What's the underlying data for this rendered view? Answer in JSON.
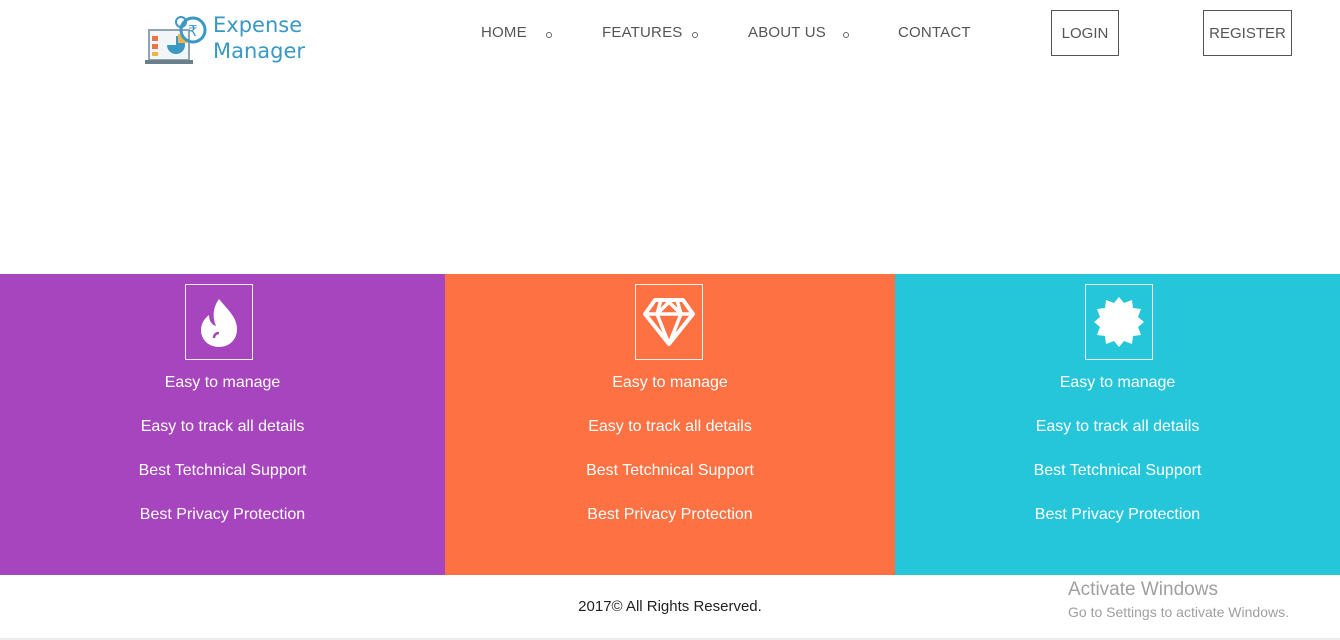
{
  "brand": {
    "line1": "Expense",
    "line2": "Manager"
  },
  "nav": {
    "home": "HOME",
    "features": "FEATURES",
    "about": "ABOUT US",
    "contact": "CONTACT",
    "login": "LOGIN",
    "register": "REGISTER"
  },
  "panels": [
    {
      "color": "#a645bd",
      "icon": "flame-icon",
      "items": [
        "Easy to manage",
        "Easy to track all details",
        "Best Tetchnical Support",
        "Best Privacy Protection"
      ]
    },
    {
      "color": "#fd7142",
      "icon": "diamond-icon",
      "items": [
        "Easy to manage",
        "Easy to track all details",
        "Best Tetchnical Support",
        "Best Privacy Protection"
      ]
    },
    {
      "color": "#26c6da",
      "icon": "badge-icon",
      "items": [
        "Easy to manage",
        "Easy to track all details",
        "Best Tetchnical Support",
        "Best Privacy Protection"
      ]
    }
  ],
  "footer": {
    "copyright": "2017© All Rights Reserved."
  },
  "watermark": {
    "title": "Activate Windows",
    "subtitle": "Go to Settings to activate Windows."
  }
}
